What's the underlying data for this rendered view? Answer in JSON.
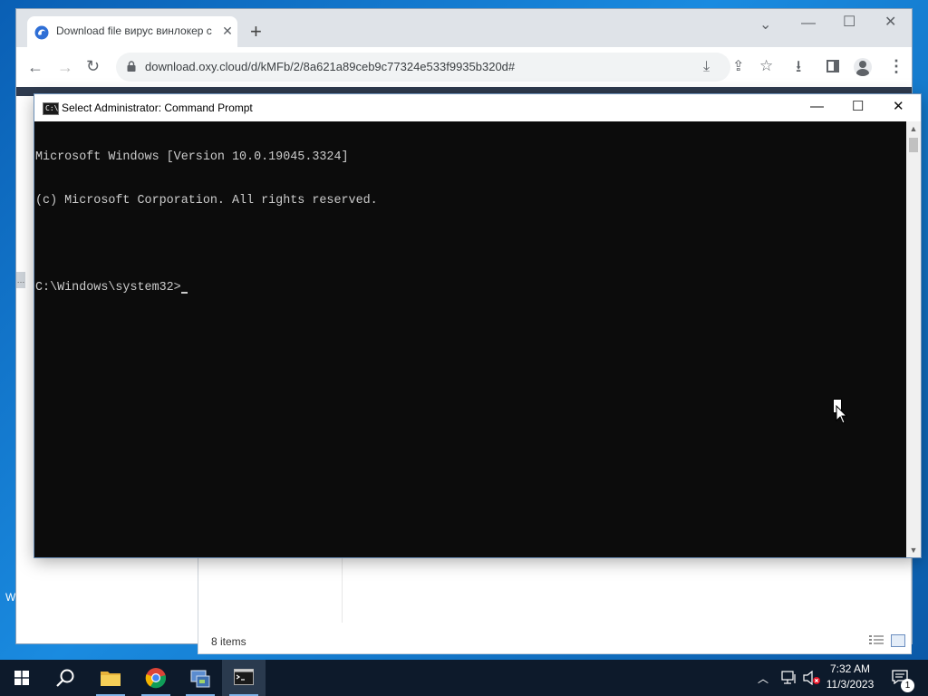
{
  "browser": {
    "tab_title": "Download file вирус винлокер с",
    "url": "download.oxy.cloud/d/kMFb/2/8a621a89ceb9c77324e533f9935b320d#"
  },
  "explorer": {
    "status_text": "8 items"
  },
  "cmd": {
    "title": "Select Administrator: Command Prompt",
    "lines": [
      "Microsoft Windows [Version 10.0.19045.3324]",
      "(c) Microsoft Corporation. All rights reserved.",
      "",
      "C:\\Windows\\system32>"
    ]
  },
  "desktop": {
    "edge_text": "W"
  },
  "taskbar": {
    "items": [
      {
        "icon": "windows-start-icon"
      },
      {
        "icon": "search-icon"
      },
      {
        "icon": "file-explorer-icon"
      },
      {
        "icon": "chrome-icon"
      },
      {
        "icon": "control-panel-icon"
      },
      {
        "icon": "command-prompt-icon"
      }
    ],
    "clock_time": "7:32 AM",
    "clock_date": "11/3/2023",
    "notification_count": "1"
  },
  "colors": {
    "desktop_blue": "#1a8be0",
    "taskbar": "#0d1a2b",
    "console_bg": "#0c0c0c",
    "console_text": "#cccccc"
  }
}
